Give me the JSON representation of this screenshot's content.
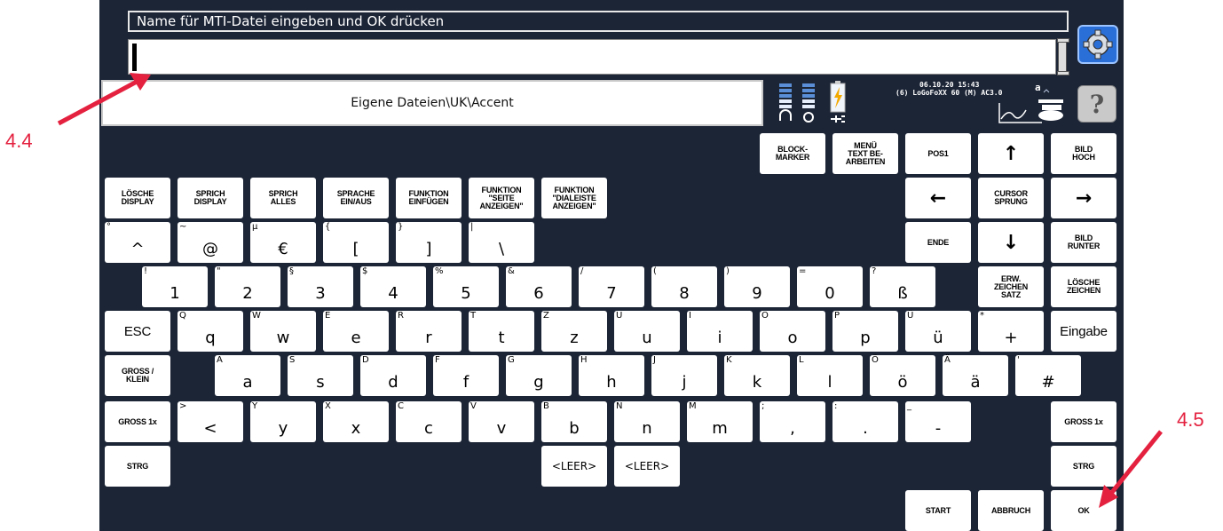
{
  "title_bar": "Name für MTI-Datei eingeben und OK drücken",
  "input": {
    "value": ""
  },
  "path": "Eigene Dateien\\UK\\Accent",
  "status": {
    "datetime": "06.10.20 15:43",
    "device": "(6) LoGoFoXX 60 (M) AC3.0",
    "font_indicator": "a"
  },
  "help_label": "?",
  "annotations": {
    "a44": "4.4",
    "a45": "4.5"
  },
  "colors": {
    "background": "#1c2536",
    "key": "#ffffff",
    "annotation": "#e4213f"
  },
  "keys": {
    "block_marker": "BLOCK-\nMARKER",
    "menu_text": "MENÜ\nTEXT BE-\nARBEITEN",
    "pos1": "POS1",
    "arrow_up": "↑",
    "bild_hoch": "BILD\nHOCH",
    "loesche_display": "LÖSCHE\nDISPLAY",
    "sprich_display": "SPRICH\nDISPLAY",
    "sprich_alles": "SPRICH\nALLES",
    "sprache_ein_aus": "SPRACHE\nEIN/AUS",
    "funktion_einfuegen": "FUNKTION\nEINFÜGEN",
    "funktion_seite": "FUNKTION\n\"SEITE\nANZEIGEN\"",
    "funktion_dialeiste": "FUNKTION\n\"DIALEISTE\nANZEIGEN\"",
    "arrow_left": "←",
    "cursor_sprung": "CURSOR\nSPRUNG",
    "arrow_right": "→",
    "ende": "ENDE",
    "arrow_down": "↓",
    "bild_runter": "BILD\nRUNTER",
    "erw_zeichen": "ERW.\nZEICHEN\nSATZ",
    "loesche_zeichen": "LÖSCHE\nZEICHEN",
    "esc": "ESC",
    "eingabe": "Eingabe",
    "gross_klein": "GROSS /\nKLEIN",
    "gross_1x_left": "GROSS 1x",
    "gross_1x_right": "GROSS 1x",
    "strg_left": "STRG",
    "strg_right": "STRG",
    "leer1": "<LEER>",
    "leer2": "<LEER>",
    "start": "START",
    "abbruch": "ABBRUCH",
    "ok": "OK"
  },
  "rows": {
    "special": [
      {
        "main": "^",
        "shift": "°"
      },
      {
        "main": "@",
        "shift": "~"
      },
      {
        "main": "€",
        "shift": "µ"
      },
      {
        "main": "[",
        "shift": "{"
      },
      {
        "main": "]",
        "shift": "}"
      },
      {
        "main": "\\",
        "shift": "|"
      }
    ],
    "digits": [
      {
        "main": "1",
        "shift": "!"
      },
      {
        "main": "2",
        "shift": "\""
      },
      {
        "main": "3",
        "shift": "§"
      },
      {
        "main": "4",
        "shift": "$"
      },
      {
        "main": "5",
        "shift": "%"
      },
      {
        "main": "6",
        "shift": "&"
      },
      {
        "main": "7",
        "shift": "/"
      },
      {
        "main": "8",
        "shift": "("
      },
      {
        "main": "9",
        "shift": ")"
      },
      {
        "main": "0",
        "shift": "="
      },
      {
        "main": "ß",
        "shift": "?"
      }
    ],
    "qwertz": [
      {
        "main": "q",
        "shift": "Q"
      },
      {
        "main": "w",
        "shift": "W"
      },
      {
        "main": "e",
        "shift": "E"
      },
      {
        "main": "r",
        "shift": "R"
      },
      {
        "main": "t",
        "shift": "T"
      },
      {
        "main": "z",
        "shift": "Z"
      },
      {
        "main": "u",
        "shift": "U"
      },
      {
        "main": "i",
        "shift": "I"
      },
      {
        "main": "o",
        "shift": "O"
      },
      {
        "main": "p",
        "shift": "P"
      },
      {
        "main": "ü",
        "shift": "Ü"
      },
      {
        "main": "+",
        "shift": "*"
      }
    ],
    "asdf": [
      {
        "main": "a",
        "shift": "A"
      },
      {
        "main": "s",
        "shift": "S"
      },
      {
        "main": "d",
        "shift": "D"
      },
      {
        "main": "f",
        "shift": "F"
      },
      {
        "main": "g",
        "shift": "G"
      },
      {
        "main": "h",
        "shift": "H"
      },
      {
        "main": "j",
        "shift": "J"
      },
      {
        "main": "k",
        "shift": "K"
      },
      {
        "main": "l",
        "shift": "L"
      },
      {
        "main": "ö",
        "shift": "Ö"
      },
      {
        "main": "ä",
        "shift": "Ä"
      },
      {
        "main": "#",
        "shift": "'"
      }
    ],
    "yxcv": [
      {
        "main": "<",
        "shift": ">"
      },
      {
        "main": "y",
        "shift": "Y"
      },
      {
        "main": "x",
        "shift": "X"
      },
      {
        "main": "c",
        "shift": "C"
      },
      {
        "main": "v",
        "shift": "V"
      },
      {
        "main": "b",
        "shift": "B"
      },
      {
        "main": "n",
        "shift": "N"
      },
      {
        "main": "m",
        "shift": "M"
      },
      {
        "main": ",",
        "shift": ";"
      },
      {
        "main": ".",
        "shift": ":"
      },
      {
        "main": "-",
        "shift": "_"
      }
    ]
  }
}
